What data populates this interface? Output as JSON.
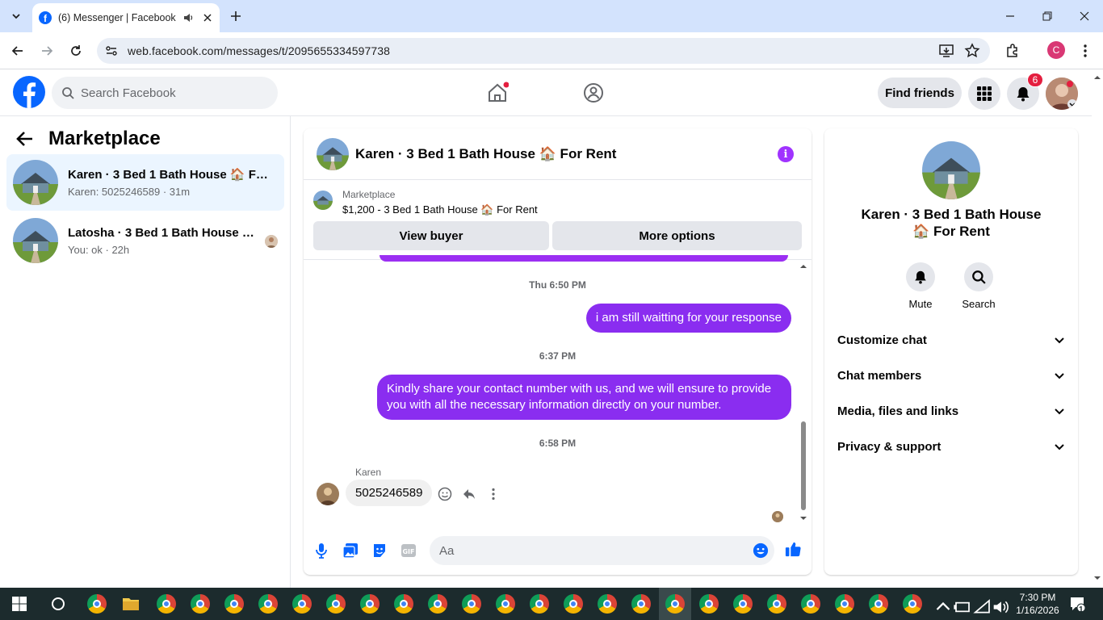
{
  "browser": {
    "tab_title": "(6) Messenger | Facebook",
    "url": "web.facebook.com/messages/t/2095655334597738",
    "profile_initial": "C"
  },
  "fb_header": {
    "search_placeholder": "Search Facebook",
    "find_friends": "Find friends",
    "notification_count": "6"
  },
  "sidebar": {
    "title": "Marketplace",
    "conversations": [
      {
        "name": "Karen · 3 Bed 1 Bath House 🏠 For Rent",
        "snippet": "Karen: 5025246589 · 31m",
        "active": true
      },
      {
        "name": "Latosha · 3 Bed 1 Bath House 🏠 For Rent",
        "snippet": "You: ok · 22h",
        "active": false
      }
    ]
  },
  "chat": {
    "title": "Karen · 3 Bed 1 Bath House 🏠 For Rent",
    "listing_label": "Marketplace",
    "listing_price_title": "$1,200 - 3 Bed 1 Bath House 🏠 For Rent",
    "view_buyer": "View buyer",
    "more_options": "More options",
    "messages": [
      {
        "type": "time",
        "text": "Thu 6:50 PM"
      },
      {
        "type": "out",
        "text": "i am still waitting for your response"
      },
      {
        "type": "time",
        "text": "6:37 PM"
      },
      {
        "type": "out",
        "text": "Kindly share your contact number with us, and we will ensure to provide you with all the necessary information directly on your number."
      },
      {
        "type": "time",
        "text": "6:58 PM"
      },
      {
        "type": "in",
        "sender": "Karen",
        "text": "5025246589"
      }
    ],
    "composer_placeholder": "Aa"
  },
  "details": {
    "name": "Karen · 3 Bed 1 Bath House 🏠 For Rent",
    "mute": "Mute",
    "search": "Search",
    "sections": [
      "Customize chat",
      "Chat members",
      "Media, files and links",
      "Privacy & support"
    ]
  },
  "taskbar": {
    "time": "7:30 PM",
    "date": "1/16/2026",
    "notif_count": "1"
  },
  "colors": {
    "accent": "#0866ff",
    "bubble_out": "#8a2df0",
    "taskbar": "#1c2b2d"
  }
}
